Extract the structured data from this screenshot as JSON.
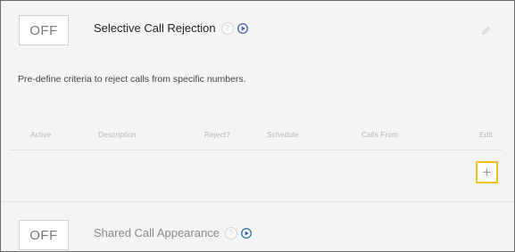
{
  "selective_call_rejection": {
    "toggle_label": "OFF",
    "title": "Selective Call Rejection",
    "help_glyph": "?",
    "description": "Pre-define criteria to reject calls from specific numbers.",
    "columns": [
      "Active",
      "Description",
      "Reject?",
      "Schedule",
      "Calls From",
      "Edit"
    ],
    "add_glyph": "+"
  },
  "shared_call_appearance": {
    "toggle_label": "OFF",
    "title": "Shared Call Appearance",
    "help_glyph": "?"
  },
  "colors": {
    "accent_play": "#1f5fa8",
    "add_highlight": "#f0c020"
  }
}
